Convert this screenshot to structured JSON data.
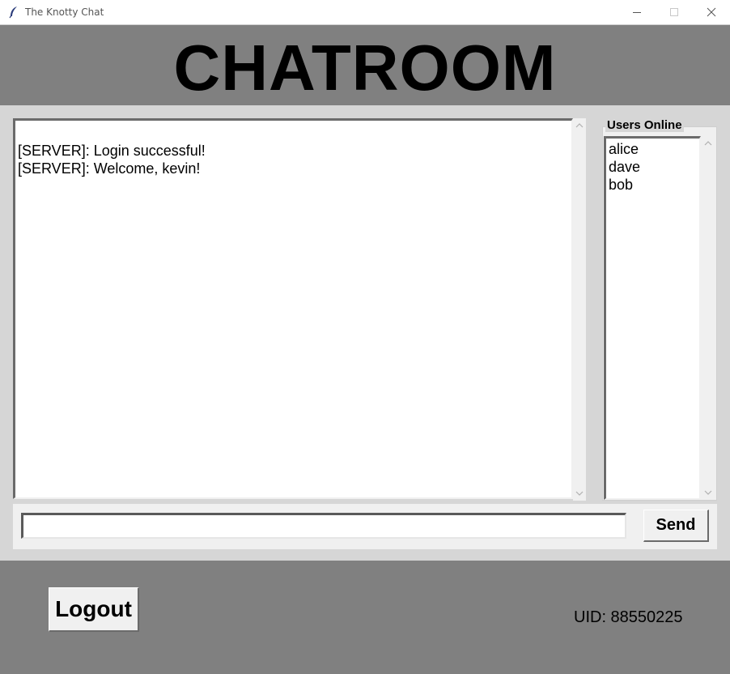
{
  "window": {
    "title": "The Knotty Chat"
  },
  "header": {
    "title": "CHATROOM"
  },
  "chat": {
    "messages": [
      "[SERVER]: Login successful!",
      "[SERVER]: Welcome, kevin!"
    ]
  },
  "users_panel": {
    "legend": "Users Online",
    "users": [
      "alice",
      "dave",
      "bob"
    ]
  },
  "composer": {
    "value": "",
    "send_label": "Send"
  },
  "footer": {
    "logout_label": "Logout",
    "uid": "UID: 88550225"
  },
  "icons": {
    "app": "feather-icon",
    "minimize": "minimize-icon",
    "maximize": "maximize-icon",
    "close": "close-icon"
  },
  "colors": {
    "background": "#808080",
    "panel": "#d6d6d6",
    "widget": "#f0f0f0"
  }
}
